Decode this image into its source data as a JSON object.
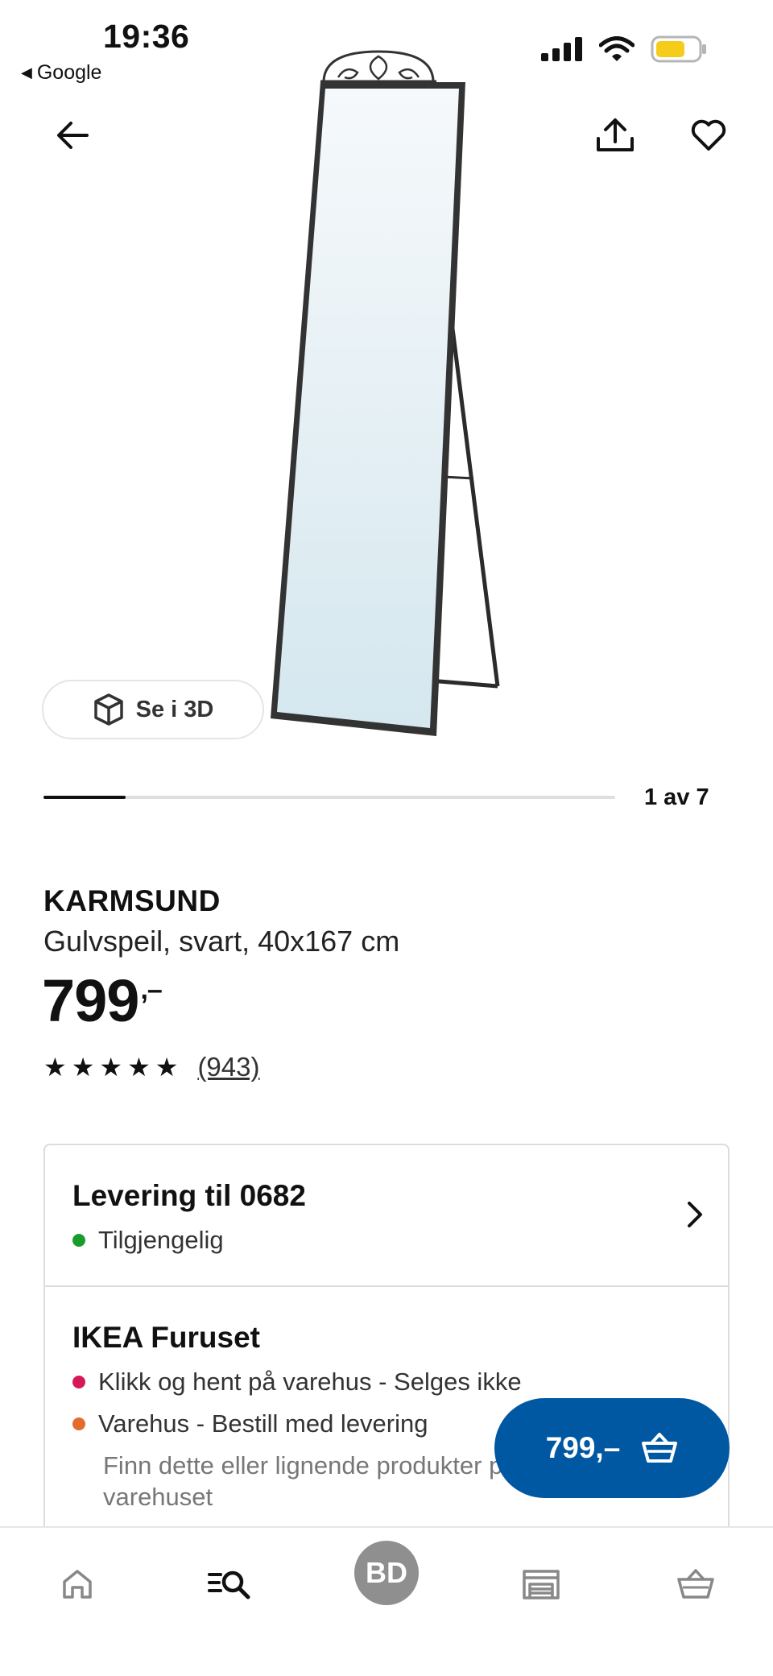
{
  "status_bar": {
    "time": "19:36",
    "back_app": "Google"
  },
  "gallery": {
    "button_3d": "Se i 3D",
    "position_label": "1 av 7",
    "progress": 0.143
  },
  "product": {
    "brand": "KARMSUND",
    "description": "Gulvspeil, svart, 40x167 cm",
    "price": "799",
    "price_suffix": ",–",
    "rating_stars": 5,
    "review_count": "(943)"
  },
  "delivery": {
    "title": "Levering til 0682",
    "status": "Tilgjengelig",
    "status_color": "#1a9c2a"
  },
  "store": {
    "title": "IKEA Furuset",
    "lines": [
      {
        "text": "Klikk og hent på varehus - Selges ikke",
        "color": "#d6185a"
      },
      {
        "text": "Varehus - Bestill med levering",
        "color": "#e36b2c"
      }
    ],
    "note": "Finn dette eller lignende produkter på varehuset"
  },
  "cart_button": {
    "label": "799,–",
    "color": "#0058a3"
  },
  "bottom_nav": {
    "avatar_initials": "BD"
  }
}
